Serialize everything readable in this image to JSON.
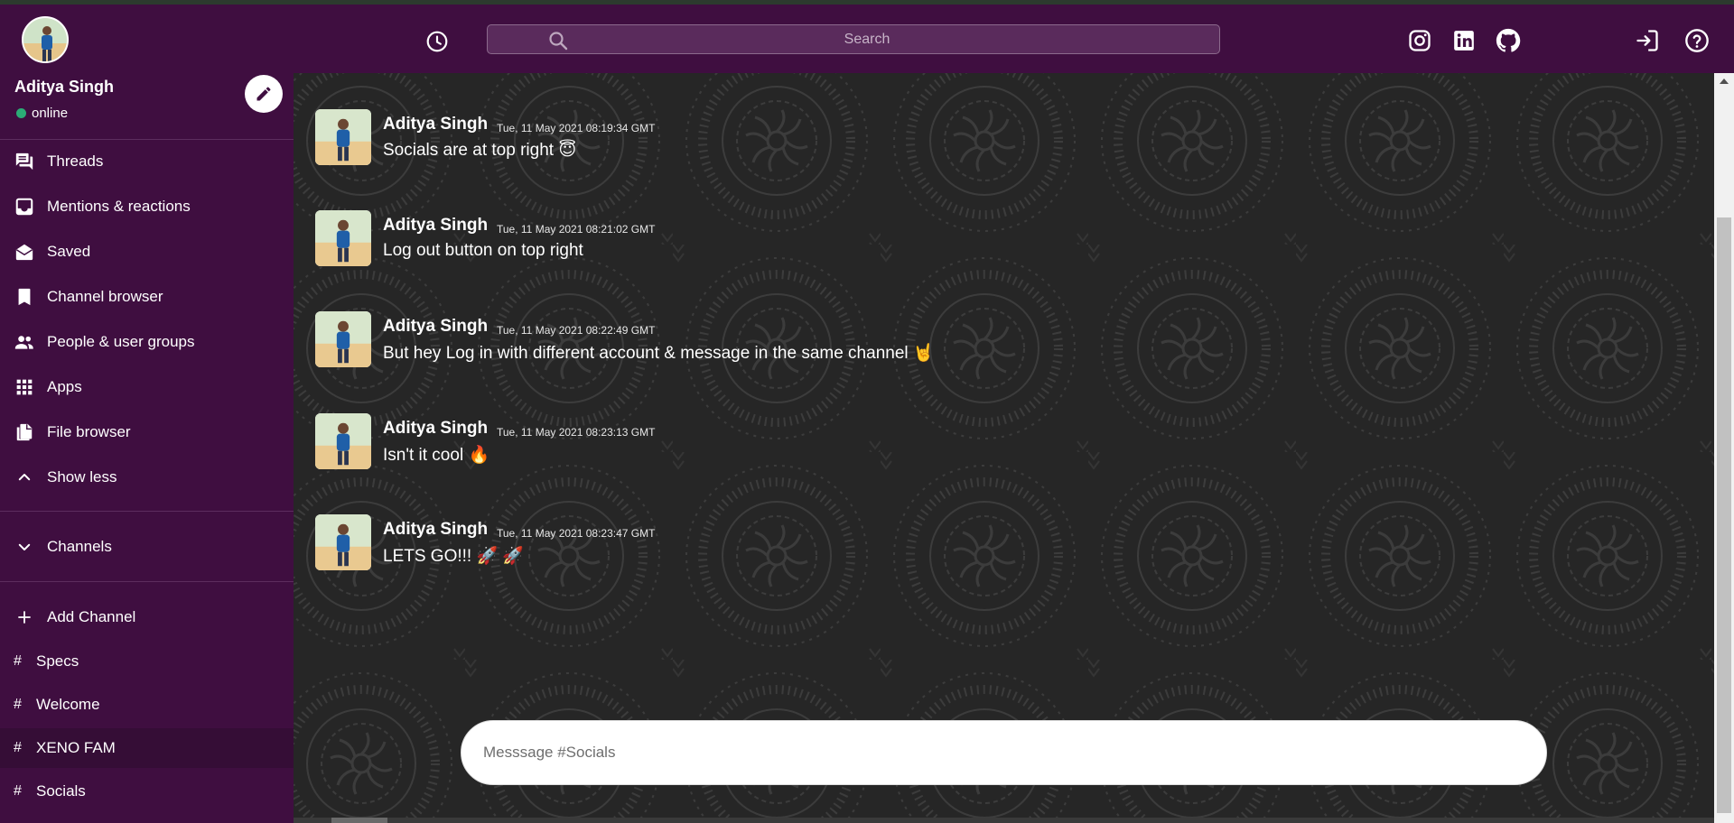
{
  "header": {
    "search_placeholder": "Search",
    "icons": [
      "history-icon",
      "search-icon",
      "instagram-icon",
      "linkedin-icon",
      "github-icon",
      "logout-icon",
      "help-icon"
    ]
  },
  "user": {
    "name": "Aditya Singh",
    "status": "online"
  },
  "sidebar": {
    "items": [
      {
        "label": "Threads",
        "icon": "threads-icon"
      },
      {
        "label": "Mentions & reactions",
        "icon": "inbox-icon"
      },
      {
        "label": "Saved",
        "icon": "drafts-icon"
      },
      {
        "label": "Channel browser",
        "icon": "bookmark-icon"
      },
      {
        "label": "People & user groups",
        "icon": "people-icon"
      },
      {
        "label": "Apps",
        "icon": "apps-icon"
      },
      {
        "label": "File browser",
        "icon": "file-copy-icon"
      },
      {
        "label": "Show less",
        "icon": "chevron-up-icon"
      }
    ],
    "channels_label": "Channels",
    "add_channel_label": "Add Channel",
    "channels": [
      {
        "hash": "#",
        "name": "Specs"
      },
      {
        "hash": "#",
        "name": "Welcome"
      },
      {
        "hash": "#",
        "name": "XENO FAM"
      },
      {
        "hash": "#",
        "name": "Socials"
      }
    ]
  },
  "messages": [
    {
      "author": "Aditya Singh",
      "time": "Tue, 11 May 2021 08:19:34 GMT",
      "text": "Socials are at top right 😇"
    },
    {
      "author": "Aditya Singh",
      "time": "Tue, 11 May 2021 08:21:02 GMT",
      "text": "Log out button on top right"
    },
    {
      "author": "Aditya Singh",
      "time": "Tue, 11 May 2021 08:22:49 GMT",
      "text": "But hey Log in with different account & message in the same channel 🤘"
    },
    {
      "author": "Aditya Singh",
      "time": "Tue, 11 May 2021 08:23:13 GMT",
      "text": "Isn't it cool 🔥"
    },
    {
      "author": "Aditya Singh",
      "time": "Tue, 11 May 2021 08:23:47 GMT",
      "text": "LETS GO!!! 🚀 🚀"
    }
  ],
  "composer": {
    "placeholder": "Messsage #Socials"
  },
  "colors": {
    "brand": "#3f0e40",
    "active_channel": "#350d36",
    "online": "#2bac76",
    "chat_bg": "#262626"
  }
}
